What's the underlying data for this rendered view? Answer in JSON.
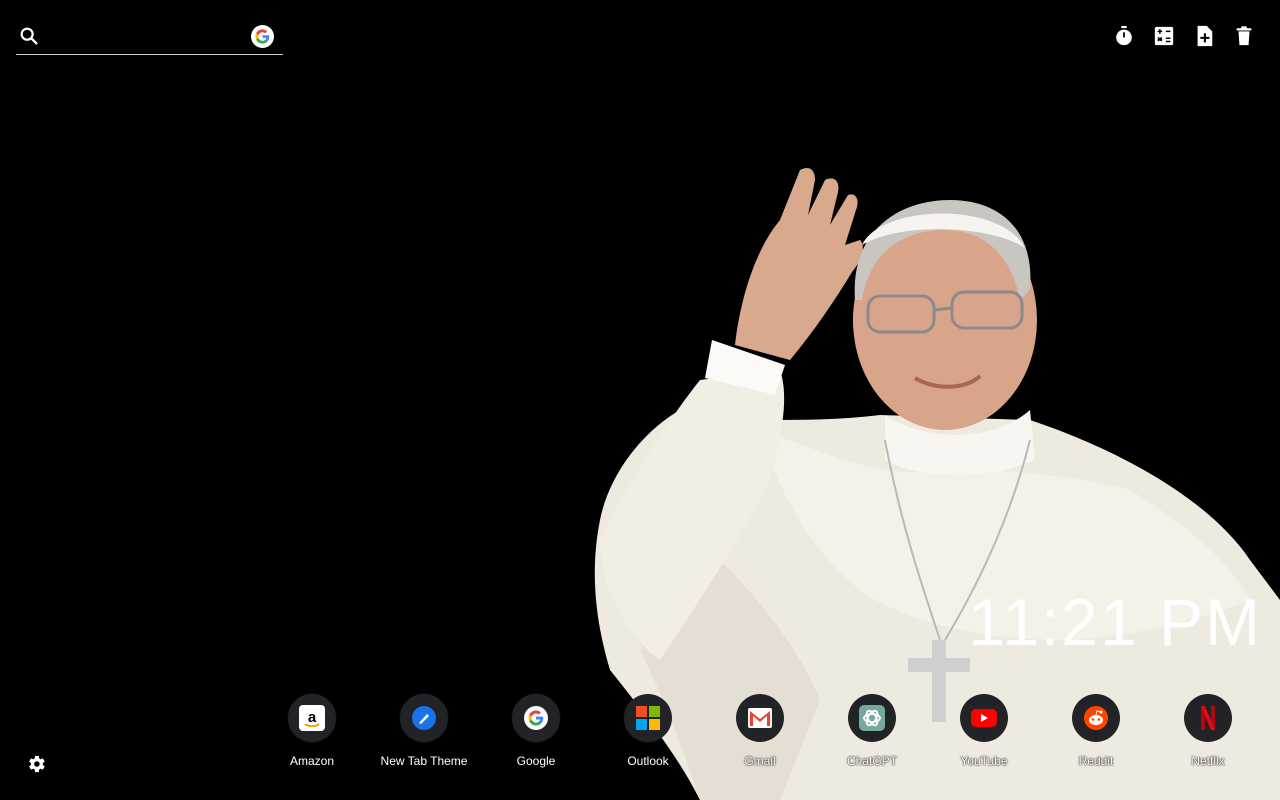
{
  "search": {
    "value": "",
    "placeholder": "",
    "engine_icon": "google-icon"
  },
  "toolbar": {
    "icons": [
      "stopwatch-icon",
      "calculator-icon",
      "new-note-icon",
      "trash-icon"
    ]
  },
  "clock": {
    "time": "11:21 PM"
  },
  "shortcuts": [
    {
      "label": "Amazon",
      "icon": "amazon-icon"
    },
    {
      "label": "New Tab Theme",
      "icon": "new-tab-theme-icon"
    },
    {
      "label": "Google",
      "icon": "google-icon"
    },
    {
      "label": "Outlook",
      "icon": "microsoft-icon"
    },
    {
      "label": "Gmail",
      "icon": "gmail-icon"
    },
    {
      "label": "ChatGPT",
      "icon": "chatgpt-icon"
    },
    {
      "label": "YouTube",
      "icon": "youtube-icon"
    },
    {
      "label": "Reddit",
      "icon": "reddit-icon"
    },
    {
      "label": "Netflix",
      "icon": "netflix-icon"
    }
  ],
  "settings": {
    "icon": "gear-icon"
  },
  "colors": {
    "background": "#000000",
    "robe": "#f1ede2",
    "text": "#ffffff"
  }
}
